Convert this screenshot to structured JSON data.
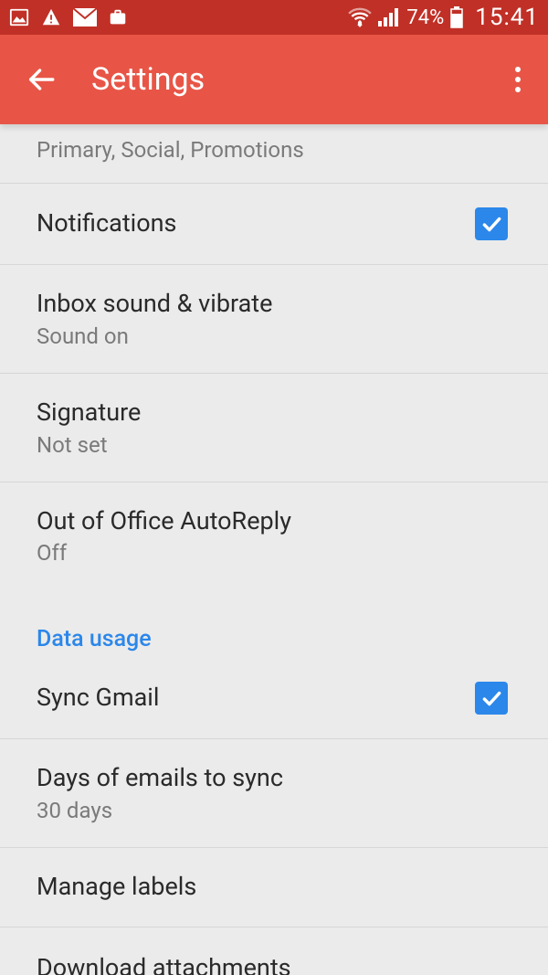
{
  "status": {
    "battery_pct": "74%",
    "time": "15:41"
  },
  "appbar": {
    "title": "Settings"
  },
  "cut_item": {
    "subtitle": "Primary, Social, Promotions"
  },
  "items": {
    "notifications": {
      "title": "Notifications",
      "checked": true
    },
    "inbox_sound": {
      "title": "Inbox sound & vibrate",
      "subtitle": "Sound on"
    },
    "signature": {
      "title": "Signature",
      "subtitle": "Not set"
    },
    "ooo": {
      "title": "Out of Office AutoReply",
      "subtitle": "Off"
    }
  },
  "section_data_usage": "Data usage",
  "items2": {
    "sync": {
      "title": "Sync Gmail",
      "checked": true
    },
    "days": {
      "title": "Days of emails to sync",
      "subtitle": "30 days"
    },
    "labels": {
      "title": "Manage labels"
    },
    "download": {
      "title": "Download attachments"
    }
  }
}
